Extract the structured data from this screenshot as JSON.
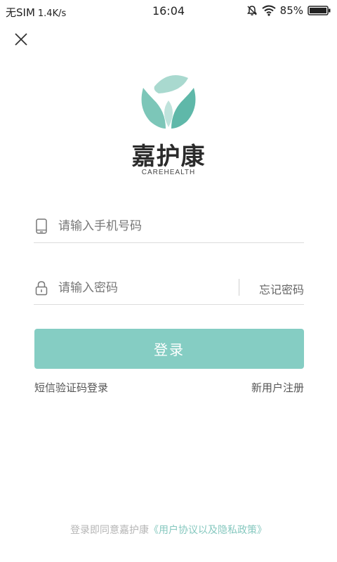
{
  "status_bar": {
    "carrier": "无SIM",
    "speed": "1.4K/s",
    "time": "16:04",
    "battery": "85%"
  },
  "brand": {
    "name": "嘉护康",
    "subtitle": "CAREHEALTH"
  },
  "form": {
    "phone_placeholder": "请输入手机号码",
    "password_placeholder": "请输入密码",
    "forgot_password": "忘记密码",
    "login_label": "登录",
    "sms_login": "短信验证码登录",
    "register": "新用户注册"
  },
  "footer": {
    "agree_text": "登录即同意嘉护康",
    "policy_link": "《用户协议以及隐私政策》"
  },
  "colors": {
    "accent": "#85cdc3",
    "logo_dark": "#5fb8a9",
    "logo_light": "#bfe3dc"
  },
  "icons": [
    "close-icon",
    "phone-icon",
    "lock-icon",
    "mute-icon",
    "wifi-icon",
    "battery-icon",
    "logo-leaf-icon"
  ]
}
